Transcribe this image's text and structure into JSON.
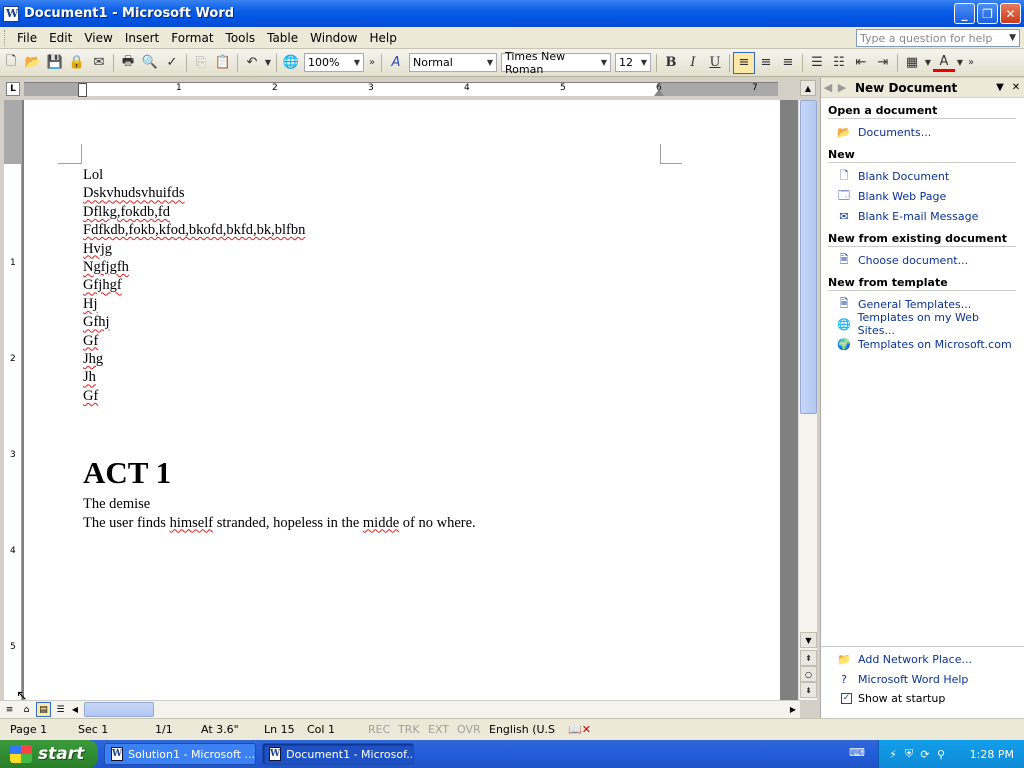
{
  "window": {
    "title": "Document1 - Microsoft Word"
  },
  "menu": [
    "File",
    "Edit",
    "View",
    "Insert",
    "Format",
    "Tools",
    "Table",
    "Window",
    "Help"
  ],
  "help_box": {
    "placeholder": "Type a question for help"
  },
  "toolbar": {
    "zoom": "100%",
    "style": "Normal",
    "font": "Times New Roman",
    "size": "12",
    "bold": "B",
    "italic": "I",
    "underline": "U",
    "font_color_letter": "A"
  },
  "ruler": {
    "tab_symbol": "L",
    "numbers": [
      "1",
      "2",
      "3",
      "4",
      "5",
      "6",
      "7"
    ],
    "vnumbers": [
      "1",
      "2",
      "3",
      "4",
      "5"
    ]
  },
  "document": {
    "lines": [
      {
        "text": "Lol",
        "spell": false
      },
      {
        "text": "Dskvhudsvhuifds",
        "spell": true
      },
      {
        "text": "Dflkg,fokdb,fd",
        "spell": true
      },
      {
        "text": "Fdfkdb,fokb,kfod,bkofd,bkfd,bk,blfbn",
        "spell": true
      },
      {
        "text": "Hvjg",
        "spell": true
      },
      {
        "text": "Ngfjgfh",
        "spell": true
      },
      {
        "text": "Gfjhgf",
        "spell": true
      },
      {
        "text": "Hj",
        "spell": true
      },
      {
        "text": "Gfhj",
        "spell": true
      },
      {
        "text": "Gf",
        "spell": true
      },
      {
        "text": "Jhg",
        "spell": true
      },
      {
        "text": "Jh",
        "spell": true
      },
      {
        "text": "Gf",
        "spell": true
      }
    ],
    "heading": "ACT 1",
    "subheading": "The demise",
    "sentence": {
      "p1": "The user finds ",
      "w1": "himself",
      "p2": " stranded, hopeless in the ",
      "w2": "midde",
      "p3": " of no where."
    }
  },
  "status": {
    "page": "Page  1",
    "sec": "Sec  1",
    "pages": "1/1",
    "at": "At  3.6\"",
    "ln": "Ln  15",
    "col": "Col  1",
    "rec": "REC",
    "trk": "TRK",
    "ext": "EXT",
    "ovr": "OVR",
    "lang": "English (U.S"
  },
  "taskpane": {
    "title": "New Document",
    "open_heading": "Open a document",
    "open_links": [
      "Documents..."
    ],
    "new_heading": "New",
    "new_links": [
      "Blank Document",
      "Blank Web Page",
      "Blank E-mail Message"
    ],
    "existing_heading": "New from existing document",
    "existing_links": [
      "Choose document..."
    ],
    "template_heading": "New from template",
    "template_links": [
      "General Templates...",
      "Templates on my Web Sites...",
      "Templates on Microsoft.com"
    ],
    "bottom_links": [
      "Add Network Place...",
      "Microsoft Word Help"
    ],
    "show_startup": "Show at startup",
    "show_startup_checked": true
  },
  "taskbar": {
    "start": "start",
    "tasks": [
      "Solution1 - Microsoft ...",
      "Document1 - Microsof..."
    ],
    "clock": "1:28 PM"
  }
}
